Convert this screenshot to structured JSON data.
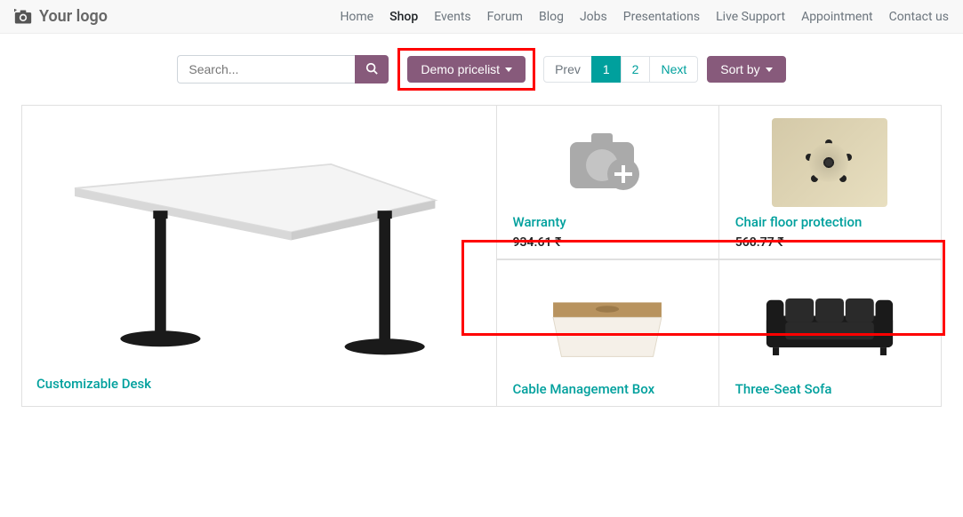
{
  "logo": {
    "text": "Your logo"
  },
  "nav": {
    "items": [
      "Home",
      "Shop",
      "Events",
      "Forum",
      "Blog",
      "Jobs",
      "Presentations",
      "Live Support",
      "Appointment",
      "Contact us"
    ],
    "active": "Shop"
  },
  "search": {
    "placeholder": "Search..."
  },
  "pricelist": {
    "label": "Demo pricelist"
  },
  "pagination": {
    "prev": "Prev",
    "next": "Next",
    "pages": [
      "1",
      "2"
    ],
    "active": "1"
  },
  "sort": {
    "label": "Sort by"
  },
  "currency": "₹",
  "products": {
    "featured": {
      "title": "Customizable Desk"
    },
    "grid": [
      {
        "title": "Warranty",
        "price": "934.61 ₹"
      },
      {
        "title": "Chair floor protection",
        "price": "560.77 ₹"
      },
      {
        "title": "Cable Management Box"
      },
      {
        "title": "Three-Seat Sofa"
      }
    ]
  }
}
